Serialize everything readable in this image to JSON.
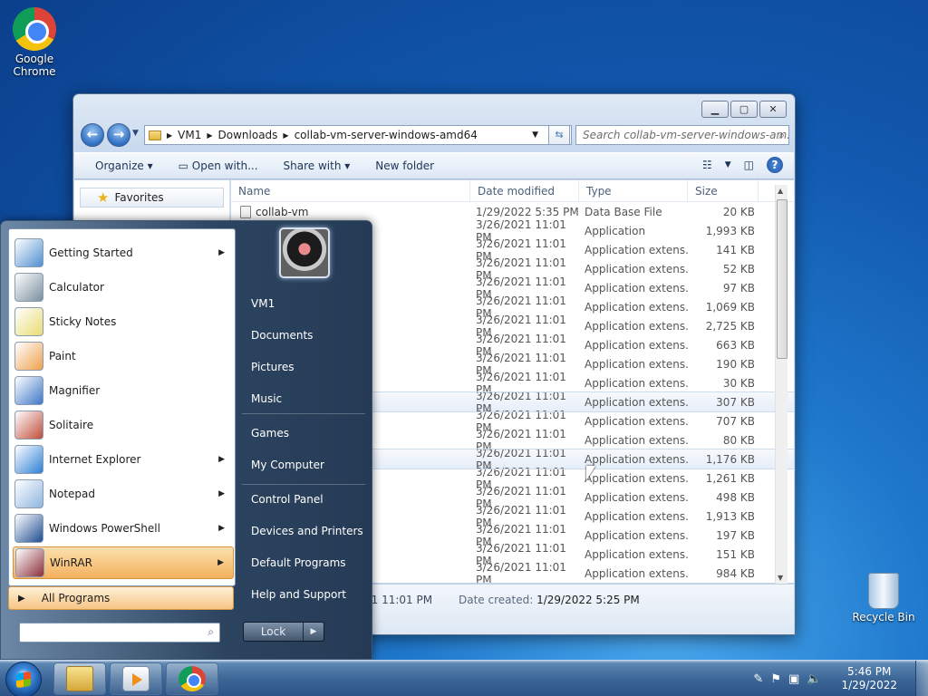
{
  "desktop": {
    "icons": [
      {
        "label_1": "Google",
        "label_2": "Chrome"
      },
      {
        "label_1": "Recycle Bin"
      }
    ]
  },
  "explorer": {
    "breadcrumb": [
      "VM1",
      "Downloads",
      "collab-vm-server-windows-amd64"
    ],
    "search_placeholder": "Search collab-vm-server-windows-am...",
    "toolbar": {
      "organize": "Organize",
      "open_with": "Open with...",
      "share_with": "Share with",
      "new_folder": "New folder"
    },
    "nav": {
      "favorites": "Favorites"
    },
    "columns": {
      "name": "Name",
      "date": "Date modified",
      "type": "Type",
      "size": "Size"
    },
    "files": [
      {
        "name": "collab-vm",
        "date": "1/29/2022 5:35 PM",
        "type": "Data Base File",
        "size": "20 KB"
      },
      {
        "name": "",
        "date": "3/26/2021 11:01 PM",
        "type": "Application",
        "size": "1,993 KB"
      },
      {
        "name": "",
        "date": "3/26/2021 11:01 PM",
        "type": "Application extens...",
        "size": "141 KB"
      },
      {
        "name": "",
        "date": "3/26/2021 11:01 PM",
        "type": "Application extens...",
        "size": "52 KB"
      },
      {
        "name": "",
        "date": "3/26/2021 11:01 PM",
        "type": "Application extens...",
        "size": "97 KB"
      },
      {
        "name": "",
        "date": "3/26/2021 11:01 PM",
        "type": "Application extens...",
        "size": "1,069 KB"
      },
      {
        "name": "",
        "date": "3/26/2021 11:01 PM",
        "type": "Application extens...",
        "size": "2,725 KB"
      },
      {
        "name": "",
        "date": "3/26/2021 11:01 PM",
        "type": "Application extens...",
        "size": "663 KB"
      },
      {
        "name": "",
        "date": "3/26/2021 11:01 PM",
        "type": "Application extens...",
        "size": "190 KB"
      },
      {
        "name": "",
        "date": "3/26/2021 11:01 PM",
        "type": "Application extens...",
        "size": "30 KB"
      },
      {
        "name": "",
        "date": "3/26/2021 11:01 PM",
        "type": "Application extens...",
        "size": "307 KB"
      },
      {
        "name": "",
        "date": "3/26/2021 11:01 PM",
        "type": "Application extens...",
        "size": "707 KB"
      },
      {
        "name": "",
        "date": "3/26/2021 11:01 PM",
        "type": "Application extens...",
        "size": "80 KB"
      },
      {
        "name": "",
        "date": "3/26/2021 11:01 PM",
        "type": "Application extens...",
        "size": "1,176 KB"
      },
      {
        "name": "",
        "date": "3/26/2021 11:01 PM",
        "type": "Application extens...",
        "size": "1,261 KB"
      },
      {
        "name": "",
        "date": "3/26/2021 11:01 PM",
        "type": "Application extens...",
        "size": "498 KB"
      },
      {
        "name": "",
        "date": "3/26/2021 11:01 PM",
        "type": "Application extens...",
        "size": "1,913 KB"
      },
      {
        "name": "",
        "date": "3/26/2021 11:01 PM",
        "type": "Application extens...",
        "size": "197 KB"
      },
      {
        "name": "",
        "date": "3/26/2021 11:01 PM",
        "type": "Application extens...",
        "size": "151 KB"
      },
      {
        "name": "",
        "date": "3/26/2021 11:01 PM",
        "type": "Application extens...",
        "size": "984 KB"
      }
    ],
    "details": {
      "modified_fragment": "21 11:01 PM",
      "created_label": "Date created:",
      "created_value": "1/29/2022 5:25 PM"
    }
  },
  "start_menu": {
    "programs": [
      {
        "label": "Getting Started",
        "has_submenu": true
      },
      {
        "label": "Calculator",
        "has_submenu": false
      },
      {
        "label": "Sticky Notes",
        "has_submenu": false
      },
      {
        "label": "Paint",
        "has_submenu": false
      },
      {
        "label": "Magnifier",
        "has_submenu": false
      },
      {
        "label": "Solitaire",
        "has_submenu": false
      },
      {
        "label": "Internet Explorer",
        "has_submenu": true
      },
      {
        "label": "Notepad",
        "has_submenu": true
      },
      {
        "label": "Windows PowerShell",
        "has_submenu": true
      },
      {
        "label": "WinRAR",
        "has_submenu": true
      }
    ],
    "all_programs": "All Programs",
    "right_items": [
      "VM1",
      "Documents",
      "Pictures",
      "Music",
      "Games",
      "My Computer",
      "Control Panel",
      "Devices and Printers",
      "Default Programs",
      "Help and Support"
    ],
    "lock": "Lock"
  },
  "taskbar": {
    "time": "5:46 PM",
    "date": "1/29/2022"
  }
}
